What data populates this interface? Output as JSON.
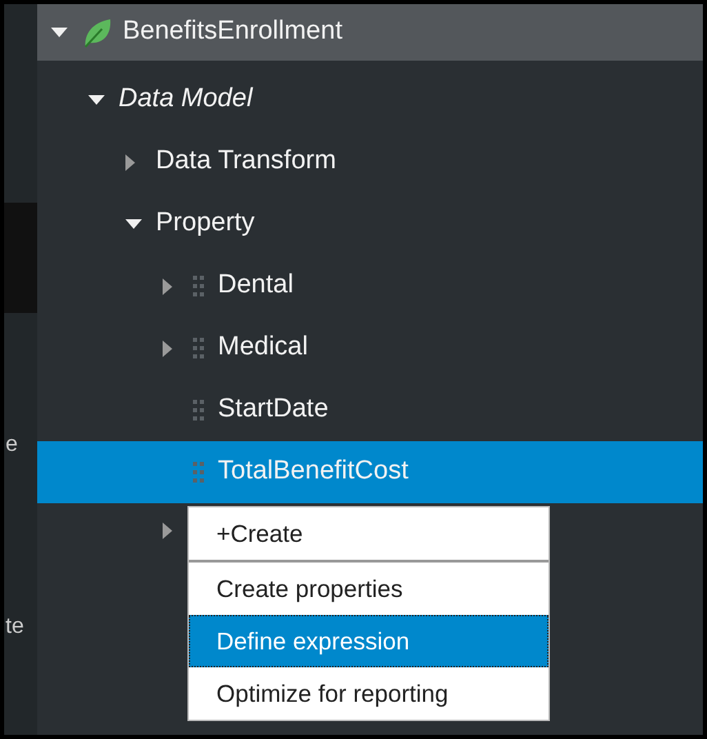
{
  "left_panel": {
    "texts": [
      "e",
      "te"
    ]
  },
  "tree": [
    {
      "label": "BenefitsEnrollment",
      "kind": "app",
      "expandable": true,
      "expanded": true,
      "selected": false,
      "children": [
        {
          "label": "Data Model",
          "kind": "category",
          "expandable": true,
          "expanded": true,
          "selected": false,
          "children": [
            {
              "label": "Data Transform",
              "kind": "folder",
              "expandable": true,
              "expanded": false,
              "selected": false
            },
            {
              "label": "Property",
              "kind": "folder",
              "expandable": true,
              "expanded": true,
              "selected": false,
              "children": [
                {
                  "label": "Dental",
                  "kind": "property",
                  "expandable": true,
                  "expanded": false,
                  "selected": false
                },
                {
                  "label": "Medical",
                  "kind": "property",
                  "expandable": true,
                  "expanded": false,
                  "selected": false
                },
                {
                  "label": "StartDate",
                  "kind": "property",
                  "expandable": false,
                  "selected": false
                },
                {
                  "label": "TotalBenefitCost",
                  "kind": "property",
                  "expandable": false,
                  "selected": true
                },
                {
                  "expandable": true,
                  "expanded": false,
                  "selected": false
                }
              ]
            }
          ]
        }
      ]
    }
  ],
  "context_menu": {
    "items": [
      {
        "label": "+Create",
        "selected": false
      },
      {
        "label": "Create properties",
        "selected": false
      },
      {
        "label": "Define expression",
        "selected": true
      },
      {
        "label": "Optimize for reporting",
        "selected": false
      }
    ]
  }
}
